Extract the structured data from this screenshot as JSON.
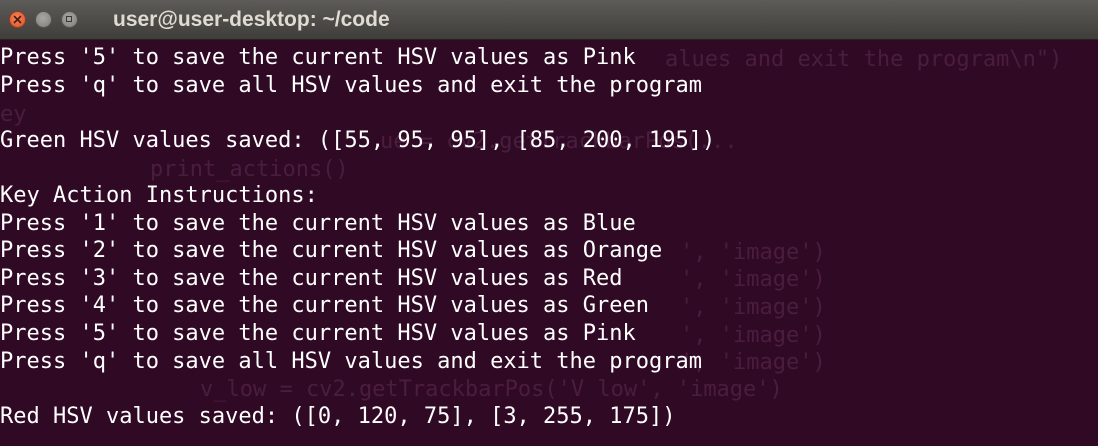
{
  "window": {
    "title": "user@user-desktop: ~/code"
  },
  "icons": {
    "close": "close-icon",
    "minimize": "minimize-icon",
    "maximize": "maximize-icon"
  },
  "colors": {
    "terminal_bg": "#300a24",
    "terminal_text": "#ffffff",
    "titlebar": "#4a4944"
  },
  "terminal": {
    "lines": [
      "Press '5' to save the current HSV values as Pink",
      "Press 'q' to save all HSV values and exit the program",
      "",
      "Green HSV values saved: ([55, 95, 95], [85, 200, 195])",
      "",
      "Key Action Instructions:",
      "Press '1' to save the current HSV values as Blue",
      "Press '2' to save the current HSV values as Orange",
      "Press '3' to save the current HSV values as Red",
      "Press '4' to save the current HSV values as Green",
      "Press '5' to save the current HSV values as Pink",
      "Press 'q' to save all HSV values and exit the program",
      "",
      "Red HSV values saved: ([0, 120, 75], [3, 255, 175])"
    ]
  },
  "background_code": {
    "fragments": [
      "alues and exit the program\\n\")",
      "ey",
      "ue = cv2.getTrackbarPos(...",
      "print_actions()",
      "', 'image')",
      "', 'image')",
      "', 'image')",
      "', 'image')",
      "', 'image')",
      "v_low = cv2.getTrackbarPos('V low', 'image')"
    ]
  }
}
